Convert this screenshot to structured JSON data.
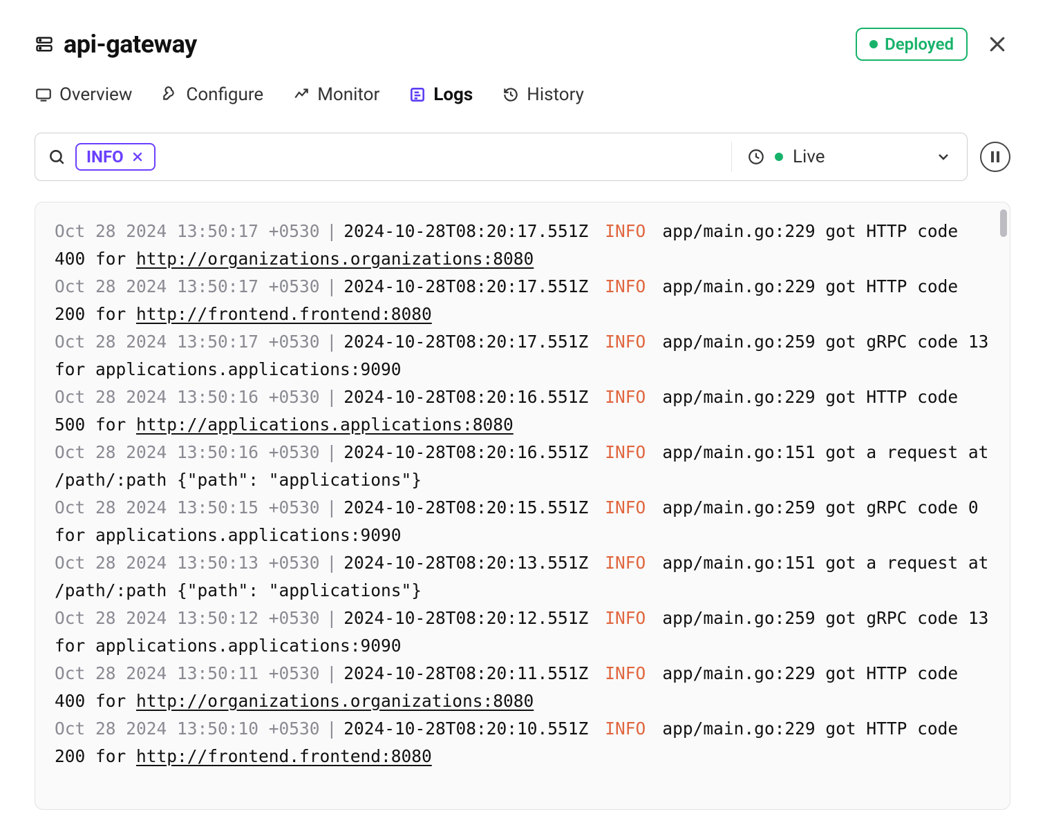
{
  "header": {
    "title": "api-gateway",
    "status": "Deployed"
  },
  "tabs": {
    "overview": "Overview",
    "configure": "Configure",
    "monitor": "Monitor",
    "logs": "Logs",
    "history": "History"
  },
  "search": {
    "chip_label": "INFO",
    "live_label": "Live"
  },
  "logs": [
    {
      "ts_local": "Oct 28 2024 13:50:17 +0530",
      "ts_iso": "2024-10-28T08:20:17.551Z",
      "level": "INFO",
      "msg_pre": "app/main.go:229 got HTTP code 400 for ",
      "url": "http://organizations.organizations:8080",
      "msg_post": ""
    },
    {
      "ts_local": "Oct 28 2024 13:50:17 +0530",
      "ts_iso": "2024-10-28T08:20:17.551Z",
      "level": "INFO",
      "msg_pre": "app/main.go:229 got HTTP code 200 for ",
      "url": "http://frontend.frontend:8080",
      "msg_post": ""
    },
    {
      "ts_local": "Oct 28 2024 13:50:17 +0530",
      "ts_iso": "2024-10-28T08:20:17.551Z",
      "level": "INFO",
      "msg_pre": "app/main.go:259 got gRPC code 13 for applications.applications:9090",
      "url": "",
      "msg_post": ""
    },
    {
      "ts_local": "Oct 28 2024 13:50:16 +0530",
      "ts_iso": "2024-10-28T08:20:16.551Z",
      "level": "INFO",
      "msg_pre": "app/main.go:229 got HTTP code 500 for ",
      "url": "http://applications.applications:8080",
      "msg_post": ""
    },
    {
      "ts_local": "Oct 28 2024 13:50:16 +0530",
      "ts_iso": "2024-10-28T08:20:16.551Z",
      "level": "INFO",
      "msg_pre": "app/main.go:151 got a request at /path/:path   {\"path\": \"applications\"}",
      "url": "",
      "msg_post": ""
    },
    {
      "ts_local": "Oct 28 2024 13:50:15 +0530",
      "ts_iso": "2024-10-28T08:20:15.551Z",
      "level": "INFO",
      "msg_pre": "app/main.go:259 got gRPC code 0 for applications.applications:9090",
      "url": "",
      "msg_post": ""
    },
    {
      "ts_local": "Oct 28 2024 13:50:13 +0530",
      "ts_iso": "2024-10-28T08:20:13.551Z",
      "level": "INFO",
      "msg_pre": "app/main.go:151 got a request at /path/:path   {\"path\": \"applications\"}",
      "url": "",
      "msg_post": ""
    },
    {
      "ts_local": "Oct 28 2024 13:50:12 +0530",
      "ts_iso": "2024-10-28T08:20:12.551Z",
      "level": "INFO",
      "msg_pre": "app/main.go:259 got gRPC code 13 for applications.applications:9090",
      "url": "",
      "msg_post": ""
    },
    {
      "ts_local": "Oct 28 2024 13:50:11 +0530",
      "ts_iso": "2024-10-28T08:20:11.551Z",
      "level": "INFO",
      "msg_pre": "app/main.go:229 got HTTP code 400 for ",
      "url": "http://organizations.organizations:8080",
      "msg_post": ""
    },
    {
      "ts_local": "Oct 28 2024 13:50:10 +0530",
      "ts_iso": "2024-10-28T08:20:10.551Z",
      "level": "INFO",
      "msg_pre": "app/main.go:229 got HTTP code 200 for ",
      "url": "http://frontend.frontend:8080",
      "msg_post": ""
    }
  ]
}
